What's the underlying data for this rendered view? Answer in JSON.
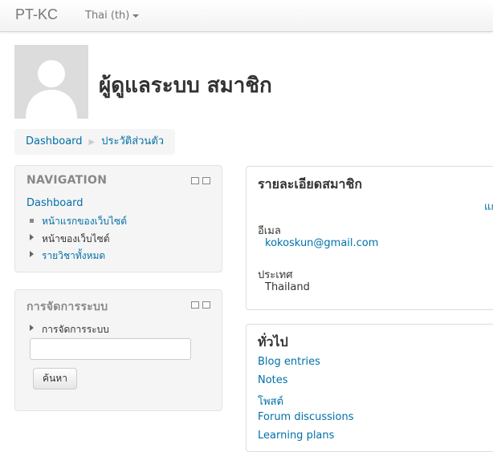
{
  "navbar": {
    "brand": "PT-KC",
    "language": "Thai (th)"
  },
  "profile": {
    "title": "ผู้ดูแลระบบ สมาชิก"
  },
  "breadcrumb": {
    "items": [
      "Dashboard",
      "ประวัติส่วนตัว"
    ]
  },
  "navigation_block": {
    "title": "NAVIGATION",
    "dashboard": "Dashboard",
    "items": [
      "หน้าแรกของเว็บไซต์",
      "หน้าของเว็บไซต์",
      "รายวิชาทั้งหมด"
    ]
  },
  "admin_block": {
    "title": "การจัดการระบบ",
    "item": "การจัดการระบบ",
    "search_value": "",
    "search_button": "ค้นหา"
  },
  "user_details": {
    "title": "รายละเอียดสมาชิก",
    "edit_link": "แก",
    "email_label": "อีเมล",
    "email": "kokoskun@gmail.com",
    "country_label": "ประเทศ",
    "country": "Thailand"
  },
  "general": {
    "title": "ทั่วไป",
    "links": [
      "Blog entries",
      "Notes",
      "โพสต์",
      "Forum discussions",
      "Learning plans"
    ]
  }
}
